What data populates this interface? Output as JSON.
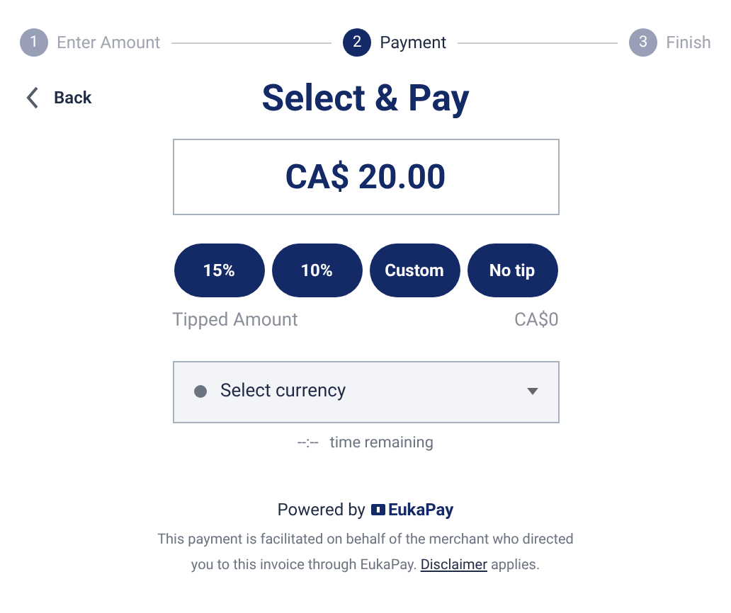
{
  "steps": [
    {
      "number": "1",
      "label": "Enter Amount",
      "selected": false
    },
    {
      "number": "2",
      "label": "Payment",
      "selected": true
    },
    {
      "number": "3",
      "label": "Finish",
      "selected": false
    }
  ],
  "back": "Back",
  "title": "Select & Pay",
  "amount": "CA$ 20.00",
  "tip_buttons": [
    "15%",
    "10%",
    "Custom",
    "No tip"
  ],
  "tipped": {
    "label": "Tipped Amount",
    "value": "CA$0"
  },
  "currency": {
    "placeholder": "Select currency"
  },
  "timer": {
    "value": "--:--",
    "label": "time remaining"
  },
  "powered": {
    "label": "Powered by",
    "brand": "EukaPay"
  },
  "footer": {
    "before": "This payment is facilitated on behalf of the merchant who directed you to this invoice through EukaPay.",
    "link": "Disclaimer",
    "after": "applies."
  }
}
